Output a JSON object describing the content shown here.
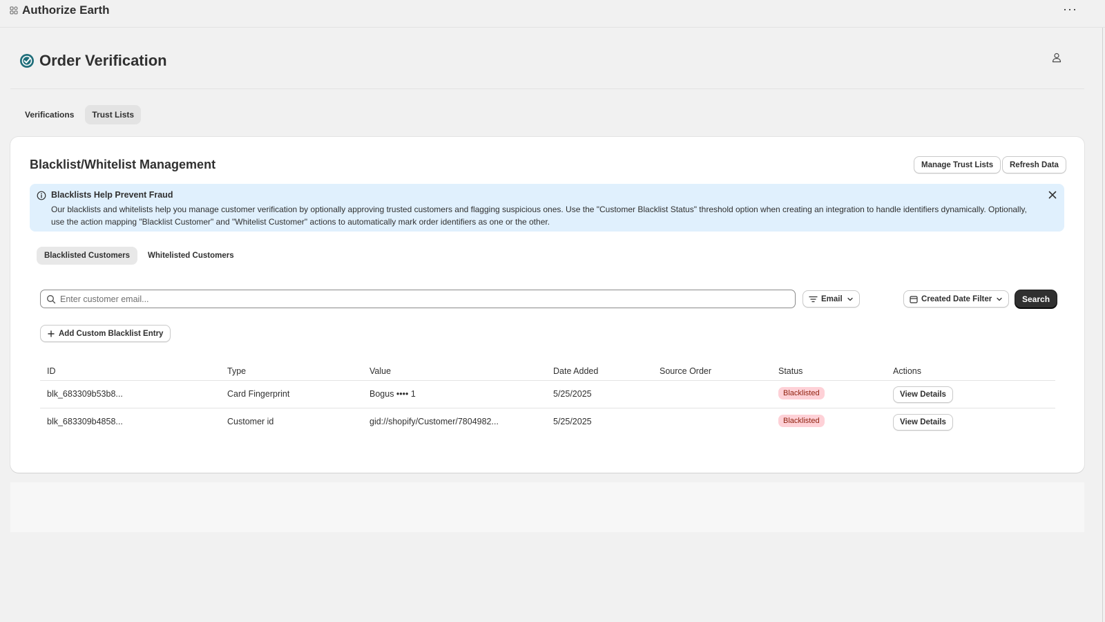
{
  "app": {
    "title": "Authorize Earth",
    "more_label": "···"
  },
  "page": {
    "title": "Order Verification"
  },
  "tabs": [
    {
      "label": "Verifications"
    },
    {
      "label": "Trust Lists"
    }
  ],
  "card": {
    "title": "Blacklist/Whitelist Management",
    "manage_label": "Manage Trust Lists",
    "refresh_label": "Refresh Data"
  },
  "banner": {
    "title": "Blacklists Help Prevent Fraud",
    "text": "Our blacklists and whitelists help you manage customer verification by optionally approving trusted customers and flagging suspicious ones. Use the \"Customer Blacklist Status\" threshold option when creating an integration to handle identifiers dynamically. Optionally, use the action mapping \"Blacklist Customer\" and \"Whitelist Customer\" actions to automatically mark order identifiers as one or the other."
  },
  "sub_tabs": [
    {
      "label": "Blacklisted Customers"
    },
    {
      "label": "Whitelisted Customers"
    }
  ],
  "search": {
    "placeholder": "Enter customer email...",
    "filter_label": "Email",
    "date_filter_label": "Created Date Filter",
    "button_label": "Search"
  },
  "add_entry_label": "Add Custom Blacklist Entry",
  "table": {
    "headers": [
      "ID",
      "Type",
      "Value",
      "Date Added",
      "Source Order",
      "Status",
      "Actions"
    ],
    "rows": [
      {
        "id": "blk_683309b53b8...",
        "type": "Card Fingerprint",
        "value": "Bogus •••• 1",
        "date": "5/25/2025",
        "source": "",
        "status": "Blacklisted",
        "action": "View Details"
      },
      {
        "id": "blk_683309b4858...",
        "type": "Customer id",
        "value": "gid://shopify/Customer/7804982...",
        "date": "5/25/2025",
        "source": "",
        "status": "Blacklisted",
        "action": "View Details"
      }
    ]
  },
  "colors": {
    "accent": "#303030",
    "info_bg": "#e0f0fd",
    "badge_bg": "#fed1d7",
    "badge_text": "#8e1f0b",
    "check_icon": "#1f6e7a"
  }
}
